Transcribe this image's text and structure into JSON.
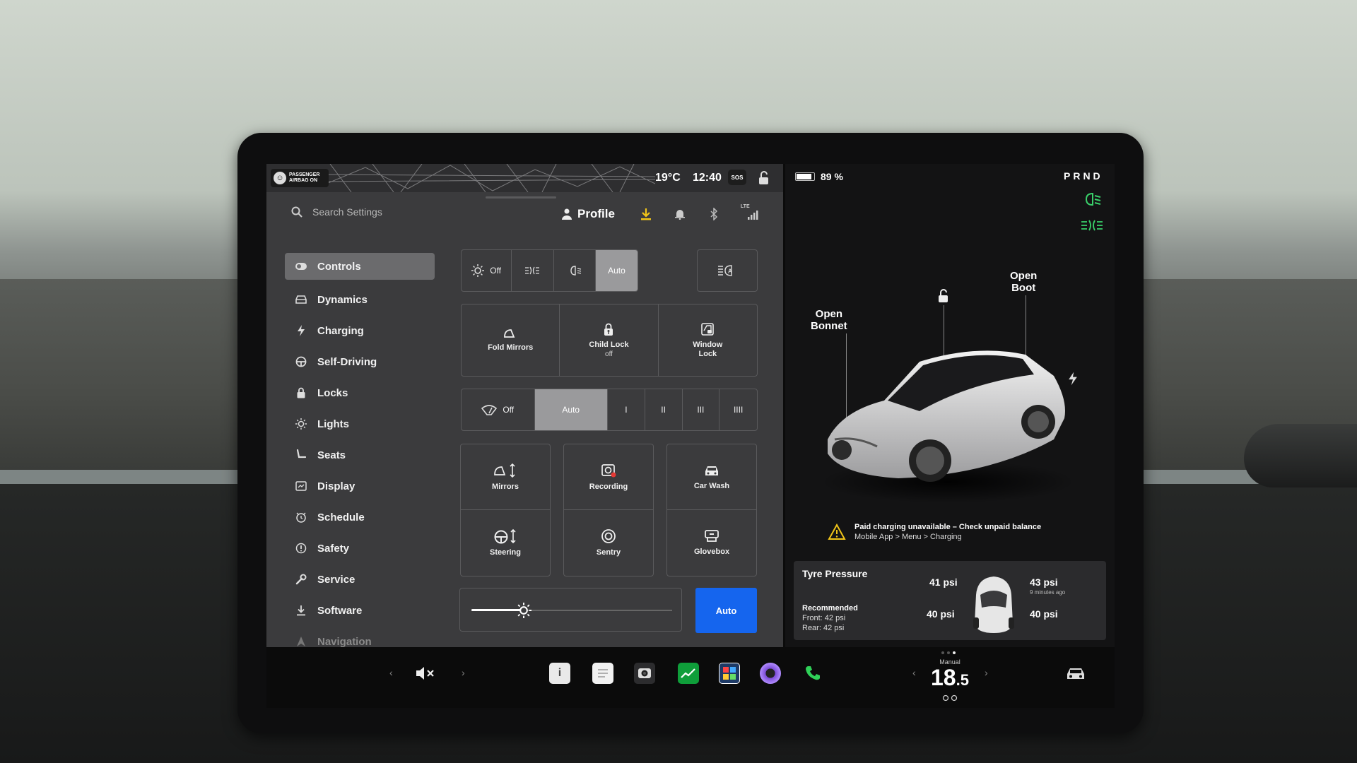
{
  "status_bar": {
    "airbag_line1": "PASSENGER",
    "airbag_line2": "AIRBAG ON",
    "temperature": "19°C",
    "time": "12:40",
    "sos": "SOS"
  },
  "header": {
    "search_placeholder": "Search Settings",
    "profile_label": "Profile",
    "icons": [
      "download-icon",
      "bell-icon",
      "bluetooth-icon",
      "lte-signal-icon"
    ],
    "lte_label": "LTE"
  },
  "sidebar": {
    "items": [
      {
        "label": "Controls",
        "icon": "toggle-icon",
        "active": true
      },
      {
        "label": "Dynamics",
        "icon": "car-icon"
      },
      {
        "label": "Charging",
        "icon": "bolt-icon"
      },
      {
        "label": "Self-Driving",
        "icon": "steering-icon"
      },
      {
        "label": "Locks",
        "icon": "lock-icon"
      },
      {
        "label": "Lights",
        "icon": "bulb-icon"
      },
      {
        "label": "Seats",
        "icon": "seat-icon"
      },
      {
        "label": "Display",
        "icon": "display-icon"
      },
      {
        "label": "Schedule",
        "icon": "clock-icon"
      },
      {
        "label": "Safety",
        "icon": "alert-icon"
      },
      {
        "label": "Service",
        "icon": "wrench-icon"
      },
      {
        "label": "Software",
        "icon": "download-icon"
      },
      {
        "label": "Navigation",
        "icon": "nav-arrow-icon"
      }
    ]
  },
  "controls": {
    "headlights": {
      "off": "Off",
      "auto": "Auto",
      "selected": "Auto"
    },
    "tiles_row1": [
      {
        "label": "Fold Mirrors",
        "sub": ""
      },
      {
        "label": "Child Lock",
        "sub": "off"
      },
      {
        "label": "Window",
        "sub": "Lock"
      }
    ],
    "wipers": {
      "off": "Off",
      "auto": "Auto",
      "levels": [
        "I",
        "II",
        "III",
        "IIII"
      ],
      "selected": "Auto"
    },
    "tiles_grid": [
      {
        "label": "Mirrors",
        "icon": "mirror-adjust-icon"
      },
      {
        "label": "Recording",
        "icon": "dashcam-icon"
      },
      {
        "label": "Car Wash",
        "icon": "car-wash-icon"
      },
      {
        "label": "Steering",
        "icon": "steering-adjust-icon"
      },
      {
        "label": "Sentry",
        "icon": "sentry-icon"
      },
      {
        "label": "Glovebox",
        "icon": "glovebox-icon"
      }
    ],
    "brightness_level": 0.26,
    "brightness_auto": "Auto"
  },
  "car_panel": {
    "battery_percent": "89 %",
    "battery_level": 0.89,
    "gear": "PRND",
    "open_bonnet_1": "Open",
    "open_bonnet_2": "Bonnet",
    "open_boot_1": "Open",
    "open_boot_2": "Boot",
    "warning_title": "Paid charging unavailable – Check unpaid balance",
    "warning_sub": "Mobile App > Menu > Charging",
    "tyre": {
      "title": "Tyre Pressure",
      "recommended": "Recommended",
      "front": "Front: 42 psi",
      "rear": "Rear: 42 psi",
      "front_left": "41 psi",
      "front_right": "43 psi",
      "rear_left": "40 psi",
      "rear_right": "40 psi",
      "updated": "9 minutes ago"
    },
    "accent_green": "#3ad16b"
  },
  "dock": {
    "volume_icon": "mute-icon",
    "apps": [
      "manual-icon",
      "notes-icon",
      "camera-icon",
      "stocks-icon",
      "toybox-icon",
      "media-icon",
      "phone-icon"
    ],
    "climate_mode": "Manual",
    "climate_temp_int": "18",
    "climate_temp_dec": ".5"
  }
}
